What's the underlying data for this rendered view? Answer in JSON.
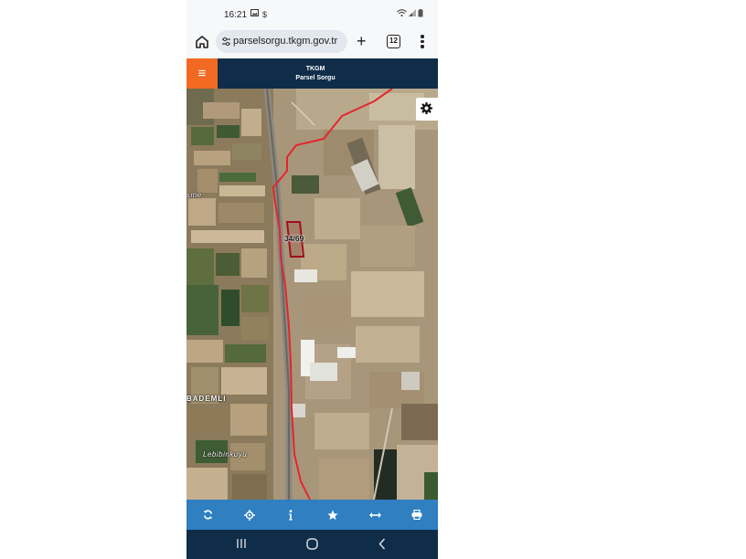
{
  "status_bar": {
    "time": "16:21",
    "icons": [
      "image-icon",
      "dollar-icon",
      "wifi-icon",
      "signal-icon",
      "battery-icon"
    ]
  },
  "browser": {
    "url": "parselsorgu.tkgm.gov.tr",
    "tab_count": "12"
  },
  "app": {
    "title_line1": "TKGM",
    "title_line2": "Parsel Sorgu"
  },
  "map": {
    "parcel_label": "34/69",
    "place_labels": [
      "şme",
      "BADEMLI",
      "Lebibinkuyu"
    ],
    "boundary_color": "#e3262d"
  },
  "toolbar": {
    "icons": [
      "refresh-icon",
      "locate-icon",
      "info-icon",
      "star-icon",
      "measure-icon",
      "print-icon"
    ],
    "color": "#2f7fc1"
  },
  "colors": {
    "header": "#0f2d48",
    "menu_button": "#f26a21"
  }
}
